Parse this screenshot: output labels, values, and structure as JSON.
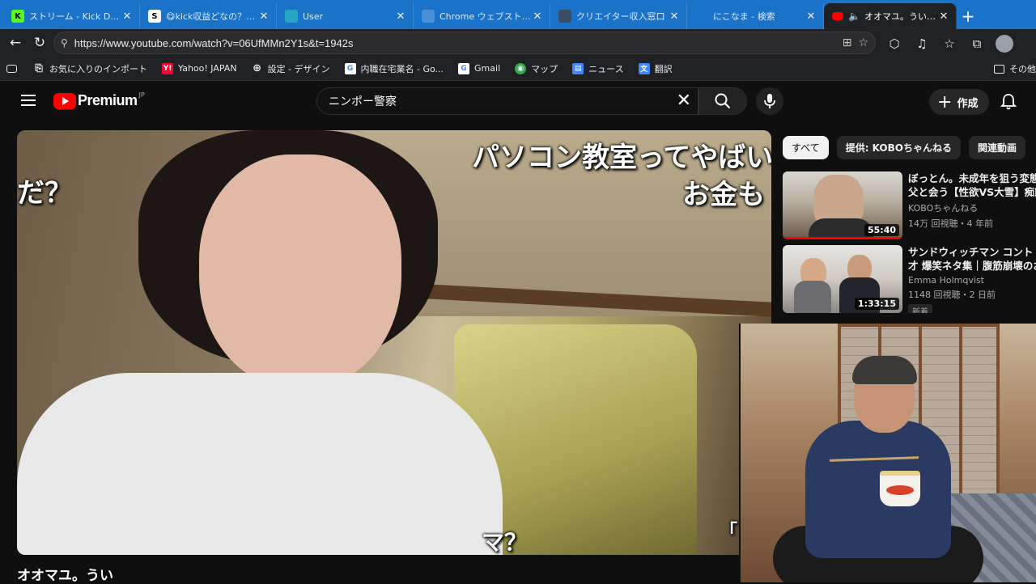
{
  "tabs": [
    {
      "title": "ストリーム - Kick Dashboard",
      "fav_bg": "#53fc18",
      "fav_char": "K"
    },
    {
      "title": "😋kick収益どなの？😋 An",
      "fav_bg": "#ffffff",
      "fav_char": "S"
    },
    {
      "title": "User",
      "fav_bg": "#27a7c4",
      "fav_char": ""
    },
    {
      "title": "Chrome ウェブストア - 拡張",
      "fav_bg": "#4a90d9",
      "fav_char": ""
    },
    {
      "title": "クリエイター収入窓口",
      "fav_bg": "#3b4d63",
      "fav_char": ""
    },
    {
      "title": "にこなま - 検索",
      "fav_bg": "#1a72c9",
      "fav_char": ""
    }
  ],
  "active_tab": {
    "title": "オオマユ。うい - YouTube",
    "fav_bg": "#ff0000"
  },
  "address": {
    "url": "https://www.youtube.com/watch?v=06UfMMn2Y1s&t=1942s"
  },
  "bookmarks": [
    {
      "label": "お気に入りのインポート",
      "bg": "#202124",
      "char": "⎘",
      "fg": "#e8eaed"
    },
    {
      "label": "Yahoo! JAPAN",
      "bg": "#ff0033",
      "char": "Y!",
      "fg": "#ffffff"
    },
    {
      "label": "設定 - デザイン",
      "bg": "#202124",
      "char": "⊕",
      "fg": "#e8eaed"
    },
    {
      "label": "内職在宅業名 - Go...",
      "bg": "#ffffff",
      "char": "G",
      "fg": "#4285f4"
    },
    {
      "label": "Gmail",
      "bg": "#ffffff",
      "char": "G",
      "fg": "#4285f4"
    },
    {
      "label": "マップ",
      "bg": "#34a853",
      "char": "◉",
      "fg": "#ffffff"
    },
    {
      "label": "ニュース",
      "bg": "#4285f4",
      "char": "▤",
      "fg": "#ffffff"
    },
    {
      "label": "翻訳",
      "bg": "#4285f4",
      "char": "文",
      "fg": "#ffffff"
    }
  ],
  "bookmarks_other": "その他",
  "youtube": {
    "logo_text": "Premium",
    "logo_region": "JP",
    "search_query": "ニンポー警察",
    "create_label": "作成"
  },
  "video": {
    "overlay_right_top": "パソコン教室ってやばい",
    "overlay_right_second": "お金も",
    "overlay_left": "だ？",
    "overlay_bottom": "マ？",
    "overlay_bottom_right": "「",
    "title": "オオマユ。うい"
  },
  "chips": [
    "すべて",
    "提供: KOBOちゃんねる",
    "関連動画"
  ],
  "recommendations": [
    {
      "title_line1": "ぼっとん。未成年を狙う変態",
      "title_line2": "父と会う【性欲VS大雪】痴態",
      "channel": "KOBOちゃんねる",
      "stats": "14万 回視聴・4 年前",
      "duration": "55:40",
      "progress": 1.0,
      "badge": ""
    },
    {
      "title_line1": "サンドウィッチマン コント・",
      "title_line2": "才 爆笑ネタ集｜腹筋崩壊のお",
      "channel": "Emma Holmqvist",
      "stats": "1148 回視聴・2 日前",
      "duration": "1:33:15",
      "progress": 0,
      "badge": "新着"
    }
  ]
}
